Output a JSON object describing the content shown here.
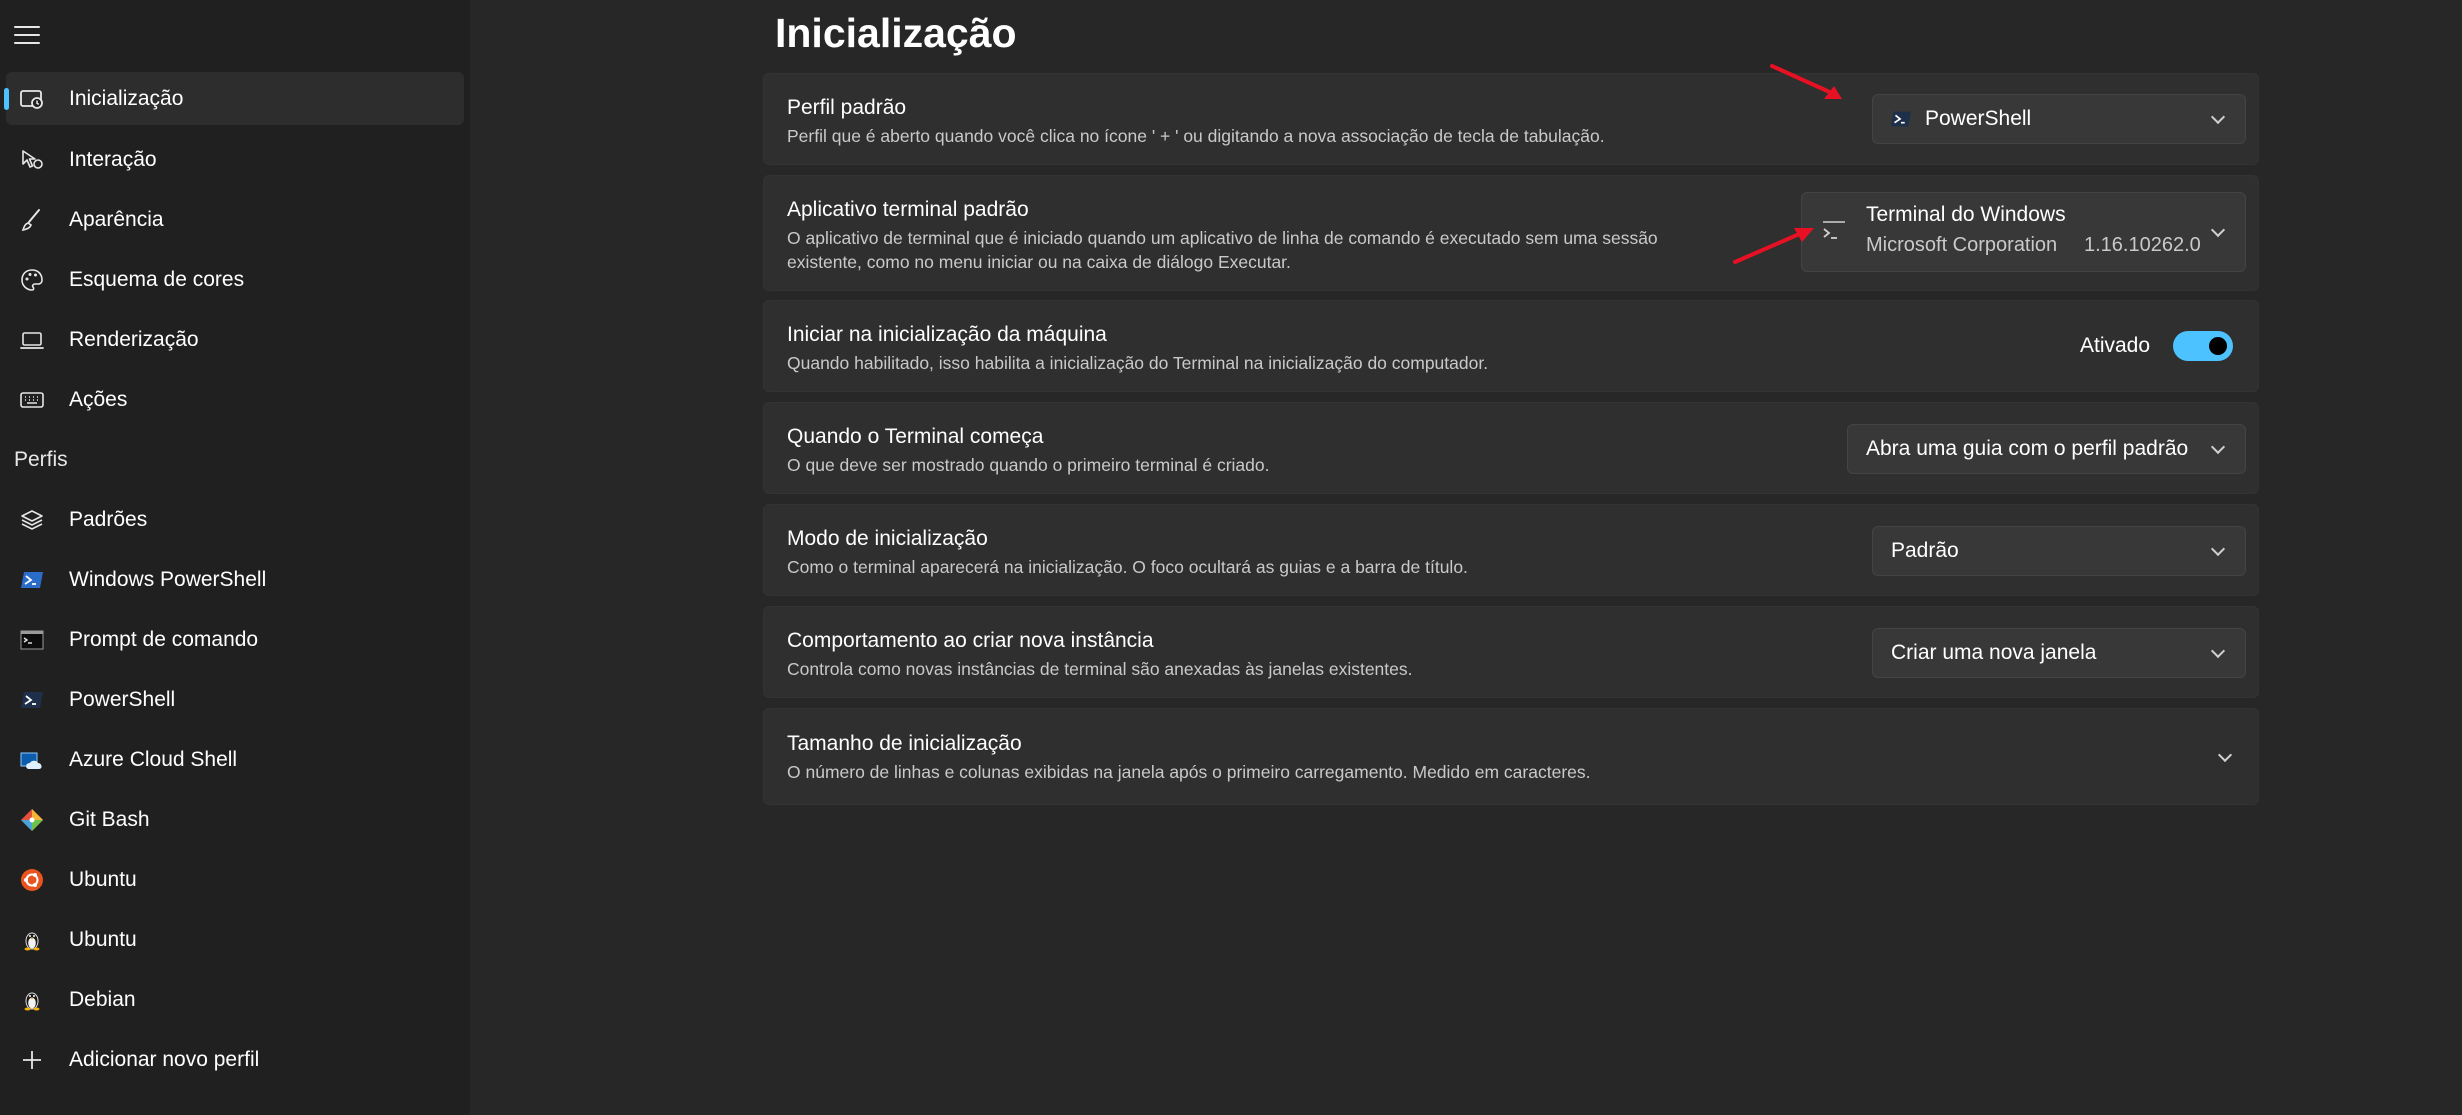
{
  "colors": {
    "accent": "#4cc2ff",
    "background": "#272727",
    "sidebar": "#202020",
    "card": "#2f2f2f",
    "annotation_arrow": "#e81123"
  },
  "sidebar": {
    "menu_icon": "hamburger-icon",
    "items": [
      {
        "label": "Inicialização",
        "icon": "startup-icon",
        "selected": true
      },
      {
        "label": "Interação",
        "icon": "pointer-icon"
      },
      {
        "label": "Aparência",
        "icon": "brush-icon"
      },
      {
        "label": "Esquema de cores",
        "icon": "palette-icon"
      },
      {
        "label": "Renderização",
        "icon": "laptop-icon"
      },
      {
        "label": "Ações",
        "icon": "keyboard-icon"
      }
    ],
    "profiles_header": "Perfis",
    "profiles": [
      {
        "label": "Padrões",
        "icon": "layers-icon"
      },
      {
        "label": "Windows PowerShell",
        "icon": "powershell-icon"
      },
      {
        "label": "Prompt de comando",
        "icon": "cmd-icon"
      },
      {
        "label": "PowerShell",
        "icon": "powershell-core-icon"
      },
      {
        "label": "Azure Cloud Shell",
        "icon": "azure-icon"
      },
      {
        "label": "Git Bash",
        "icon": "git-icon"
      },
      {
        "label": "Ubuntu",
        "icon": "ubuntu-icon"
      },
      {
        "label": "Ubuntu",
        "icon": "linux-penguin-icon"
      },
      {
        "label": "Debian",
        "icon": "linux-penguin-icon"
      },
      {
        "label": "Adicionar novo perfil",
        "icon": "plus-icon"
      }
    ]
  },
  "main": {
    "title": "Inicialização",
    "settings": [
      {
        "title": "Perfil padrão",
        "description": "Perfil que é aberto quando você clica no ícone ' + ' ou digitando a nova associação de tecla de tabulação.",
        "control": {
          "type": "dropdown",
          "value": "PowerShell",
          "icon": "powershell-core-icon"
        }
      },
      {
        "title": "Aplicativo terminal padrão",
        "description_line1": "O aplicativo de terminal que é iniciado quando um aplicativo de linha de comando é executado sem uma sessão",
        "description_line2": "existente, como no menu iniciar ou na caixa de diálogo Executar.",
        "control": {
          "type": "dropdown",
          "value": "Terminal do Windows",
          "publisher": "Microsoft Corporation",
          "version": "1.16.10262.0",
          "icon": "terminal-icon"
        }
      },
      {
        "title": "Iniciar na inicialização da máquina",
        "description": "Quando habilitado, isso habilita a inicialização do Terminal na inicialização do computador.",
        "control": {
          "type": "toggle",
          "state_label": "Ativado",
          "on": true
        }
      },
      {
        "title": "Quando o Terminal começa",
        "description": "O que deve ser mostrado quando o primeiro terminal é criado.",
        "control": {
          "type": "dropdown",
          "value": "Abra uma guia com o perfil padrão"
        }
      },
      {
        "title": "Modo de inicialização",
        "description": "Como o terminal aparecerá na inicialização. O foco ocultará as guias e a barra de título.",
        "control": {
          "type": "dropdown",
          "value": "Padrão"
        }
      },
      {
        "title": "Comportamento ao criar nova instância",
        "description": "Controla como novas instâncias de terminal são anexadas às janelas existentes.",
        "control": {
          "type": "dropdown",
          "value": "Criar uma nova janela"
        }
      },
      {
        "title": "Tamanho de inicialização",
        "description": "O número de linhas e colunas exibidas na janela após o primeiro carregamento. Medido em caracteres.",
        "control": {
          "type": "expander"
        }
      }
    ]
  }
}
